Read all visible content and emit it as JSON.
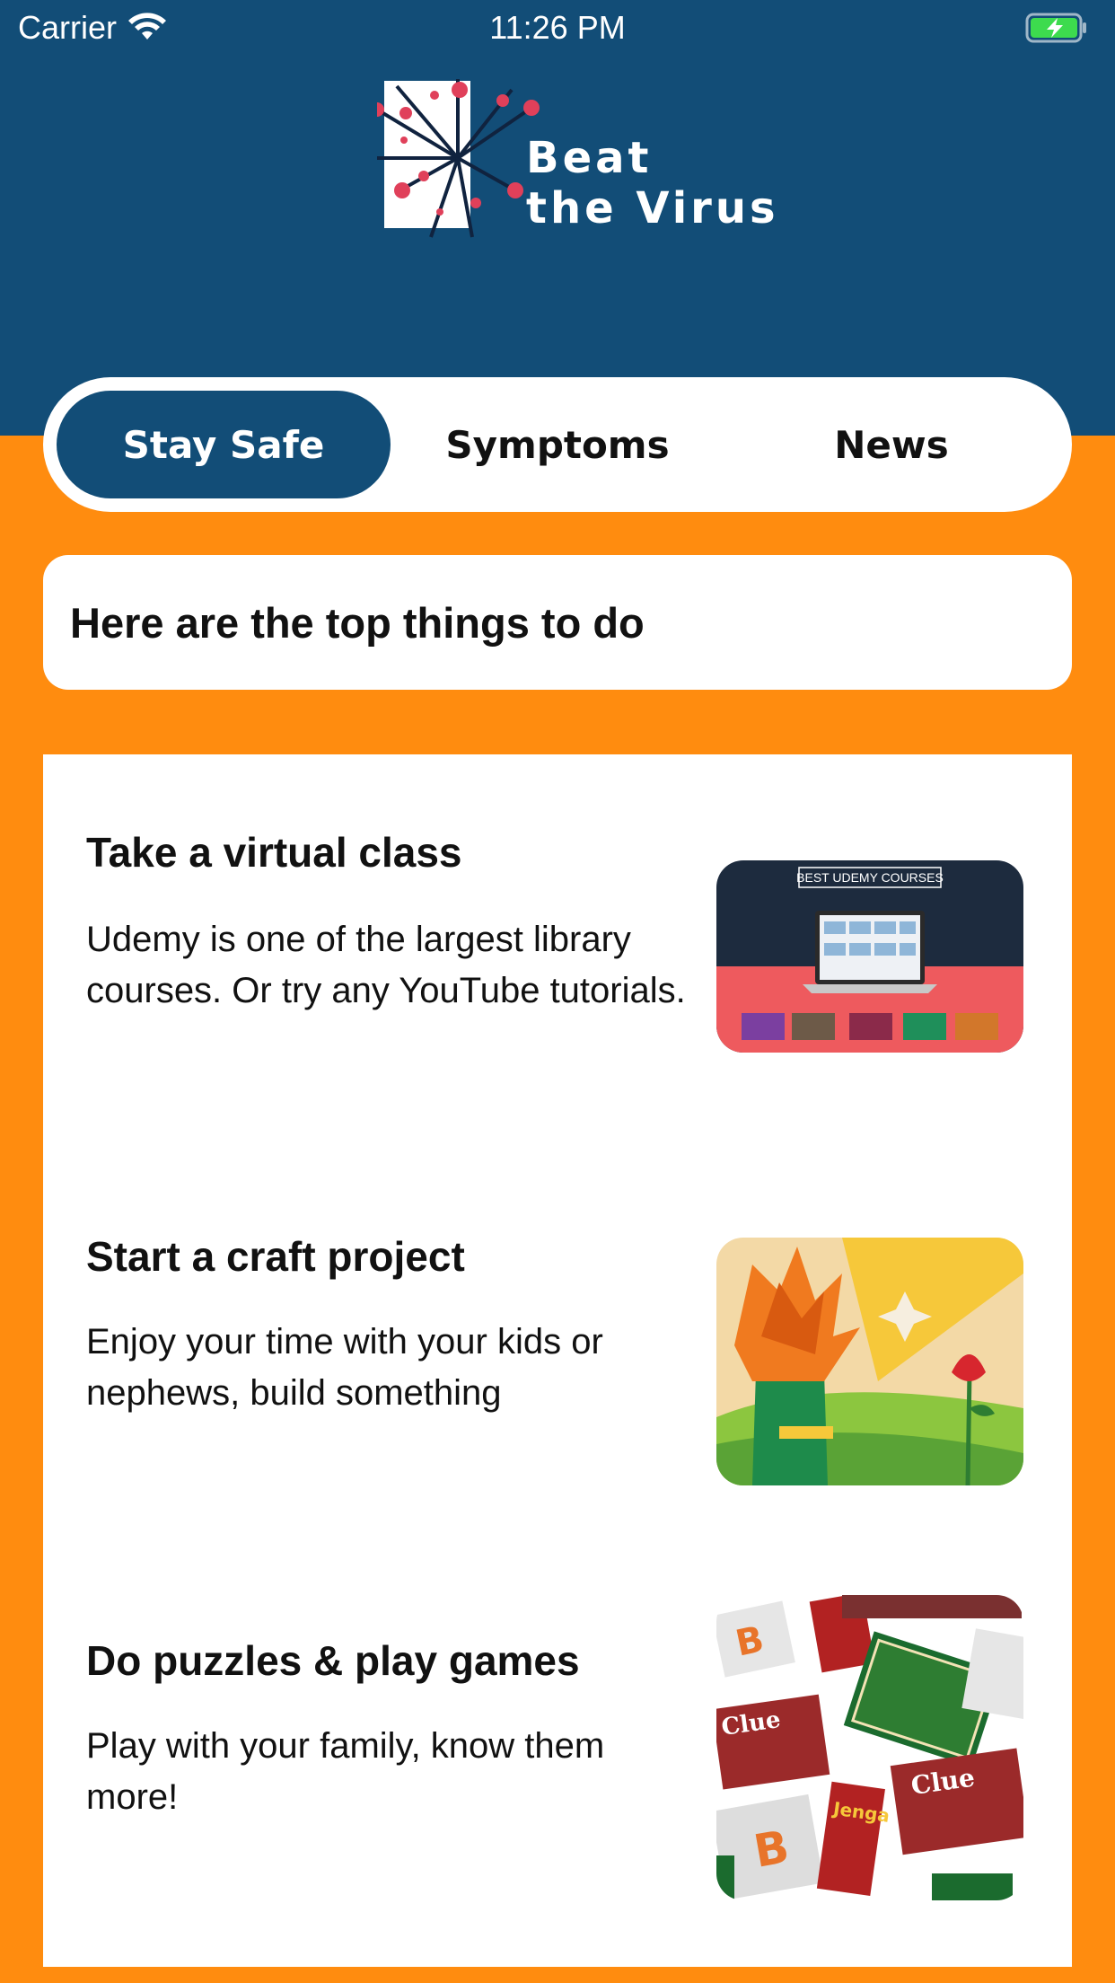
{
  "status_bar": {
    "carrier": "Carrier",
    "time": "11:26 PM",
    "icons": [
      "wifi-icon",
      "battery-charging-icon"
    ]
  },
  "header": {
    "logo_line1": "Beat",
    "logo_line2": "the Virus"
  },
  "tabs": [
    {
      "label": "Stay Safe",
      "selected": true
    },
    {
      "label": "Symptoms",
      "selected": false
    },
    {
      "label": "News",
      "selected": false
    }
  ],
  "intro": {
    "text": "Here are the top things to do"
  },
  "items": [
    {
      "title": "Take a virtual class",
      "description": "Udemy is one of the largest library courses. Or try any YouTube tutorials.",
      "image_caption": "BEST UDEMY COURSES"
    },
    {
      "title": "Start a craft project",
      "description": "Enjoy your time with your kids or nephews, build something"
    },
    {
      "title": "Do puzzles & play games",
      "description": "Play with your family, know them more!",
      "image_labels": [
        "Clue",
        "Jenga"
      ]
    }
  ],
  "colors": {
    "primary": "#124D77",
    "accent": "#FF8C0F",
    "virus_dot": "#E0405A"
  }
}
